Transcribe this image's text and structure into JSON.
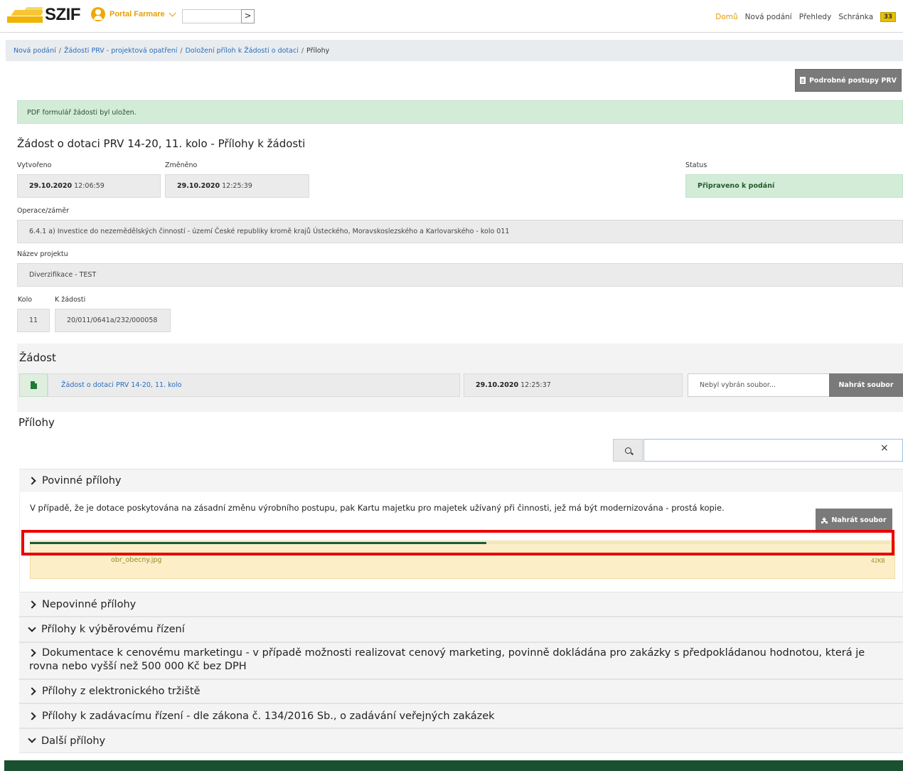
{
  "header": {
    "logo_text": "SZIF",
    "portal_label": "Portal Farmare",
    "quick_button": ">",
    "nav": [
      {
        "label": "Domů"
      },
      {
        "label": "Nová podání"
      },
      {
        "label": "Přehledy"
      },
      {
        "label": "Schránka"
      }
    ],
    "inbox_count": "33"
  },
  "breadcrumb": [
    {
      "label": "Nová podání"
    },
    {
      "label": "Žádosti PRV - projektová opatření"
    },
    {
      "label": "Doložení příloh k Žádosti o dotaci"
    },
    {
      "label": "Přílohy"
    }
  ],
  "actions": {
    "detailed_procedures": "Podrobné postupy PRV"
  },
  "alert": "PDF formulář žádosti byl uložen.",
  "request": {
    "title": "Žádost o dotaci PRV 14-20, 11. kolo - Přílohy k žádosti",
    "created_label": "Vytvořeno",
    "created_date": "29.10.2020",
    "created_time": "12:06:59",
    "changed_label": "Změněno",
    "changed_date": "29.10.2020",
    "changed_time": "12:25:39",
    "status_label": "Status",
    "status_value": "Připraveno k podání",
    "operation_label": "Operace/záměr",
    "operation_value": "6.4.1 a) Investice do nezemědělských činností - území České republiky kromě krajů Ústeckého, Moravskoslezského a Karlovarského - kolo 011",
    "project_label": "Název projektu",
    "project_value": "Diverzifikace - TEST",
    "round_label": "Kolo",
    "round_value": "11",
    "ref_label": "K žádosti",
    "ref_value": "20/011/0641a/232/000058"
  },
  "zadost": {
    "section_title": "Žádost",
    "doc_link": "Žádost o dotaci PRV 14-20, 11. kolo",
    "doc_date": "29.10.2020",
    "doc_time": "12:25:37",
    "file_placeholder": "Nebyl vybrán soubor...",
    "upload_label": "Nahrát soubor"
  },
  "prilohy": {
    "section_title": "Přílohy",
    "search_clear": "×",
    "mandatory": {
      "title": "Povinné přílohy",
      "description": "V případě, že je dotace poskytována na zásadní změnu výrobního postupu, pak Kartu majetku pro majetek užívaný při činnosti, jež má být modernizována - prostá kopie.",
      "upload_label": "Nahrát soubor",
      "file": {
        "name": "obr_obecny.jpg",
        "size": "42KB",
        "progress": 0.53
      }
    },
    "optional_title": "Nepovinné přílohy",
    "tender_title": "Přílohy k výběrovému řízení",
    "price_marketing": "Dokumentace k cenovému marketingu - v případě možnosti realizovat cenový marketing, povinně dokládána pro zakázky s předpokládanou hodnotou, která je rovna nebo vyšší než 500 000 Kč bez DPH",
    "e_market": "Přílohy z elektronického tržiště",
    "procurement": "Přílohy k zadávacímu řízení - dle zákona č. 134/2016 Sb., o zadávání veřejných zakázek",
    "other": "Další přílohy"
  },
  "colors": {
    "accent": "#e89e00",
    "footer": "#1a4f2f",
    "progress": "#1d5b3a",
    "highlight": "#ea0000"
  }
}
